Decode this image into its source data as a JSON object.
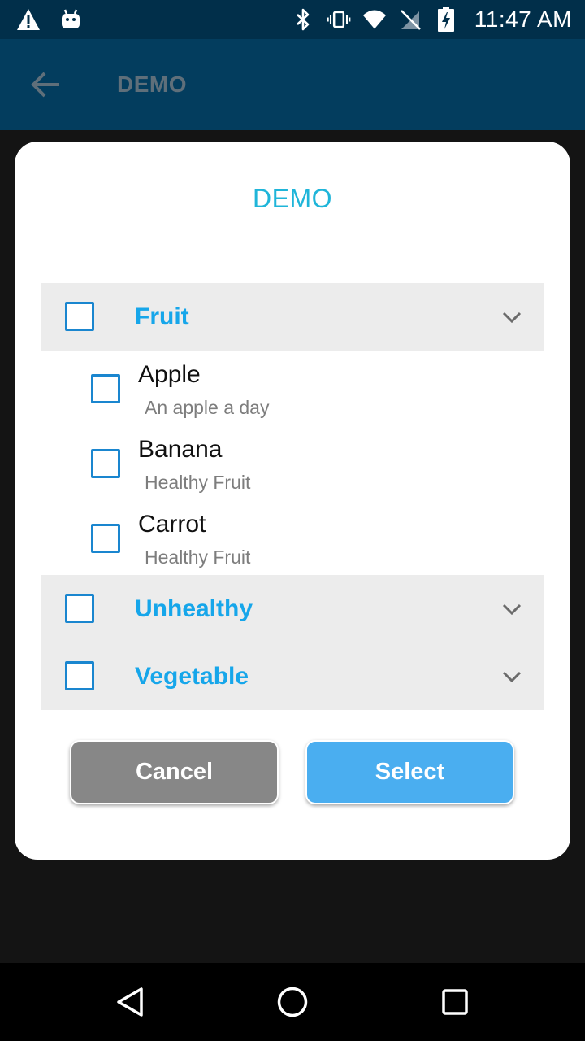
{
  "status_bar": {
    "time": "11:47 AM",
    "left_icons": [
      "warning-icon",
      "android-icon"
    ],
    "right_icons": [
      "bluetooth-icon",
      "vibrate-icon",
      "wifi-icon",
      "no-sim-icon",
      "battery-charging-icon"
    ]
  },
  "app_bar": {
    "title": "DEMO",
    "back_icon": "arrow-left-icon"
  },
  "dialog": {
    "title": "DEMO",
    "groups": [
      {
        "label": "Fruit",
        "checked": false,
        "expanded": true,
        "items": [
          {
            "title": "Apple",
            "subtitle": "An apple a day",
            "checked": false
          },
          {
            "title": "Banana",
            "subtitle": "Healthy Fruit",
            "checked": false
          },
          {
            "title": "Carrot",
            "subtitle": "Healthy Fruit",
            "checked": false
          }
        ]
      },
      {
        "label": "Unhealthy",
        "checked": false,
        "expanded": false
      },
      {
        "label": "Vegetable",
        "checked": false,
        "expanded": false
      }
    ],
    "cancel_label": "Cancel",
    "select_label": "Select"
  },
  "nav_bar": {
    "icons": [
      "back-triangle-icon",
      "home-circle-icon",
      "recents-square-icon"
    ]
  },
  "colors": {
    "accent": "#16a6ea",
    "title": "#1fb5d9",
    "checkbox": "#1a86cf",
    "select_button": "#4aaef0",
    "cancel_button": "#878787"
  }
}
